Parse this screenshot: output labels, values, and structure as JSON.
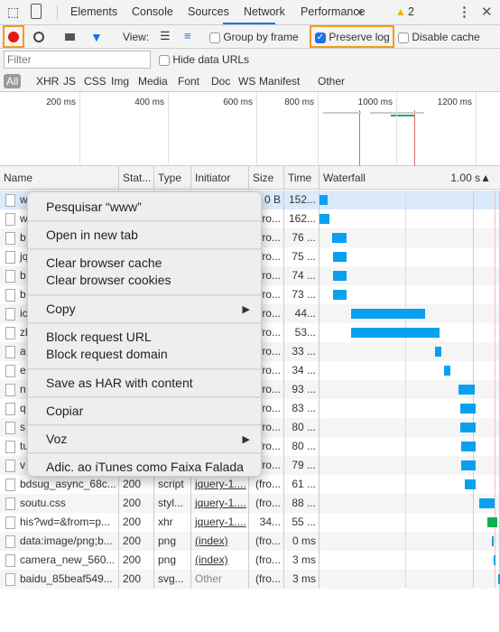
{
  "tabs": [
    "Elements",
    "Console",
    "Sources",
    "Network",
    "Performance"
  ],
  "active_tab": "Network",
  "more_tabs_icon": "»",
  "warning_count": "2",
  "toolbar": {
    "view_label": "View:",
    "group_by_frame": "Group by frame",
    "group_by_frame_checked": false,
    "preserve_log": "Preserve log",
    "preserve_log_checked": true,
    "disable_cache": "Disable cache",
    "disable_cache_checked": false
  },
  "filter": {
    "placeholder": "Filter",
    "hide_data_urls": "Hide data URLs"
  },
  "types": [
    "All",
    "XHR",
    "JS",
    "CSS",
    "Img",
    "Media",
    "Font",
    "Doc",
    "WS",
    "Manifest",
    "Other"
  ],
  "overview_ticks": [
    "200 ms",
    "400 ms",
    "600 ms",
    "800 ms",
    "1000 ms",
    "1200 ms"
  ],
  "columns": [
    "Name",
    "Stat...",
    "Type",
    "Initiator",
    "Size",
    "Time",
    "Waterfall"
  ],
  "waterfall_sort": "1.00 s▲",
  "colors": {
    "accent": "#1a73e8",
    "highlight": "#f29b1d",
    "bar": "#0aa0f0",
    "record": "#e8170e",
    "green": "#10b050"
  },
  "rows": [
    {
      "name": "w",
      "status": "",
      "type": "",
      "initiator": "",
      "size": "0 B",
      "time": "152...",
      "wf": [
        0,
        60
      ]
    },
    {
      "name": "w",
      "status": "",
      "type": "",
      "initiator": "",
      "size": "(fro...",
      "time": "162...",
      "wf": [
        0,
        75
      ]
    },
    {
      "name": "b",
      "status": "",
      "type": "",
      "initiator": "",
      "size": "(fro...",
      "time": "76 ...",
      "wf": [
        95,
        205
      ]
    },
    {
      "name": "jq",
      "status": "",
      "type": "",
      "initiator": "",
      "size": "(fro...",
      "time": "75 ...",
      "wf": [
        100,
        205
      ]
    },
    {
      "name": "b",
      "status": "",
      "type": "",
      "initiator": "",
      "size": "(fro...",
      "time": "74 ...",
      "wf": [
        100,
        205
      ]
    },
    {
      "name": "b",
      "status": "",
      "type": "",
      "initiator": "",
      "size": "(fro...",
      "time": "73 ...",
      "wf": [
        100,
        205
      ]
    },
    {
      "name": "ic",
      "status": "",
      "type": "",
      "initiator": "",
      "size": "(fro...",
      "time": "44...",
      "wf": [
        240,
        795
      ]
    },
    {
      "name": "zl",
      "status": "",
      "type": "",
      "initiator": "",
      "size": "(fro...",
      "time": "53...",
      "wf": [
        240,
        905
      ]
    },
    {
      "name": "a",
      "status": "",
      "type": "",
      "initiator": "",
      "size": "(fro...",
      "time": "33 ...",
      "wf": [
        870,
        920
      ]
    },
    {
      "name": "e",
      "status": "",
      "type": "",
      "initiator": "",
      "size": "(fro...",
      "time": "34 ...",
      "wf": [
        940,
        985
      ]
    },
    {
      "name": "n",
      "status": "",
      "type": "",
      "initiator": "",
      "size": "(fro...",
      "time": "93 ...",
      "wf": [
        1050,
        1170
      ]
    },
    {
      "name": "q",
      "status": "",
      "type": "",
      "initiator": "",
      "size": "(fro...",
      "time": "83 ...",
      "wf": [
        1060,
        1175
      ]
    },
    {
      "name": "s",
      "status": "",
      "type": "",
      "initiator": "",
      "size": "(fro...",
      "time": "80 ...",
      "wf": [
        1060,
        1175
      ]
    },
    {
      "name": "tu",
      "status": "",
      "type": "",
      "initiator": "",
      "size": "(fro...",
      "time": "80 ...",
      "wf": [
        1065,
        1175
      ]
    },
    {
      "name": "v",
      "status": "",
      "type": "",
      "initiator": "",
      "size": "(fro...",
      "time": "79 ...",
      "wf": [
        1065,
        1175
      ]
    },
    {
      "name": "bdsug_async_68c...",
      "status": "200",
      "type": "script",
      "initiator": "jquery-1....",
      "size": "(fro...",
      "time": "61 ...",
      "wf": [
        1095,
        1175
      ]
    },
    {
      "name": "soutu.css",
      "status": "200",
      "type": "styl...",
      "initiator": "jquery-1....",
      "size": "(fro...",
      "time": "88 ...",
      "wf": [
        1205,
        1320
      ]
    },
    {
      "name": "his?wd=&from=p...",
      "status": "200",
      "type": "xhr",
      "initiator": "jquery-1....",
      "size": "34...",
      "time": "55 ...",
      "wf": [
        1265,
        1340
      ]
    },
    {
      "name": "data:image/png;b...",
      "status": "200",
      "type": "png",
      "initiator": "(index)",
      "size": "(fro...",
      "time": "0 ms",
      "wf": [
        1300,
        1310
      ]
    },
    {
      "name": "camera_new_560...",
      "status": "200",
      "type": "png",
      "initiator": "(index)",
      "size": "(fro...",
      "time": "3 ms",
      "wf": [
        1312,
        1325
      ]
    },
    {
      "name": "baidu_85beaf549...",
      "status": "200",
      "type": "svg...",
      "initiator": "Other",
      "size": "(fro...",
      "time": "3 ms",
      "wf": [
        1345,
        1360
      ]
    }
  ],
  "menu": [
    {
      "label": "Pesquisar “www”"
    },
    {
      "label": "Open in new tab"
    },
    {
      "label": "Clear browser cache",
      "label2": "Clear browser cookies"
    },
    {
      "label": "Copy",
      "submenu": true
    },
    {
      "label": "Block request URL",
      "label2": "Block request domain"
    },
    {
      "label": "Save as HAR with content"
    },
    {
      "label": "Copiar"
    },
    {
      "label": "Voz",
      "submenu": true
    },
    {
      "label": "Adic. ao iTunes como Faixa Falada"
    }
  ]
}
